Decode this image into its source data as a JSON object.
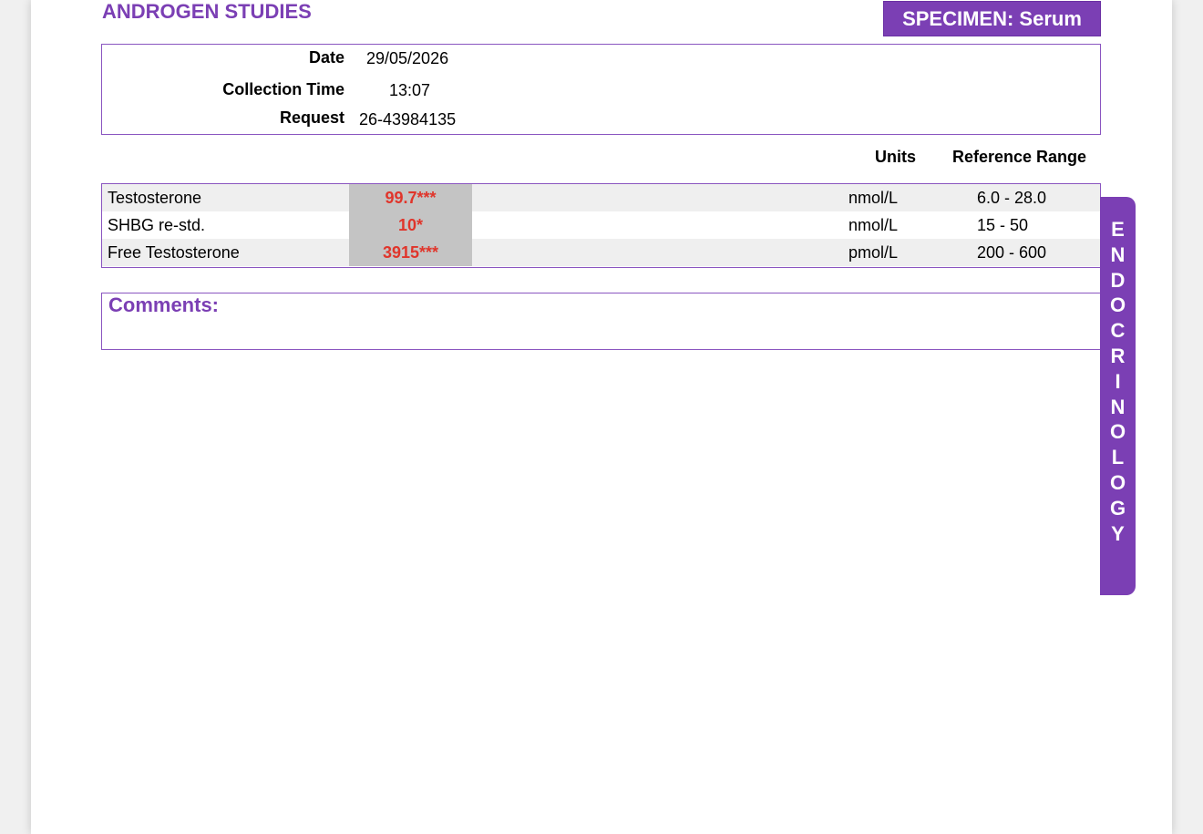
{
  "header": {
    "title": "ANDROGEN STUDIES",
    "specimen": "SPECIMEN: Serum"
  },
  "info": {
    "date_label": "Date",
    "date_value": "29/05/2026",
    "collection_time_label": "Collection Time",
    "collection_time_value": "13:07",
    "request_label": "Request",
    "request_value": "26-43984135"
  },
  "columns": {
    "units": "Units",
    "reference_range": "Reference Range"
  },
  "results": [
    {
      "name": "Testosterone",
      "result": "99.7***",
      "units": "nmol/L",
      "range": "6.0 - 28.0"
    },
    {
      "name": "SHBG re-std.",
      "result": "10*",
      "units": "nmol/L",
      "range": "15 - 50"
    },
    {
      "name": "Free Testosterone",
      "result": "3915***",
      "units": "pmol/L",
      "range": "200 - 600"
    }
  ],
  "comments": {
    "label": "Comments:"
  },
  "side_tab": {
    "text": "ENDOCRINOLOGY"
  },
  "colors": {
    "accent": "#7b3fb4",
    "abnormal_result": "#e0352b",
    "result_cell_bg": "#c4c4c4",
    "row_shade": "#efefef"
  }
}
